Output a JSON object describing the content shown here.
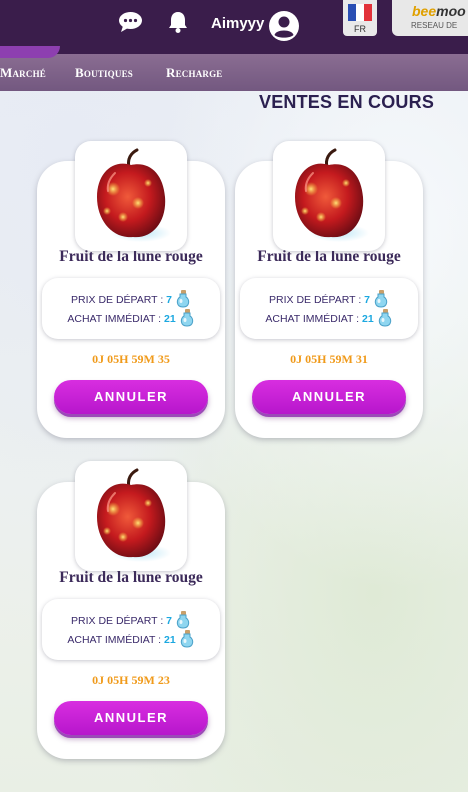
{
  "header": {
    "username": "Aimyyy",
    "lang_code": "FR",
    "brand_logo_a": "bee",
    "brand_logo_b": "moo",
    "brand_sub": "RESEAU DE"
  },
  "nav": {
    "items": [
      {
        "label": "Marché"
      },
      {
        "label": "Boutiques"
      },
      {
        "label": "Recharge"
      }
    ]
  },
  "page_title": "VENTES EN COURS",
  "listings": [
    {
      "name": "Fruit de la lune rouge",
      "start_label": "PRIX DE DÉPART :",
      "start_value": "7",
      "buy_label": "ACHAT IMMÉDIAT :",
      "buy_value": "21",
      "timer": "0J 05H 59M 35",
      "button": "ANNULER"
    },
    {
      "name": "Fruit de la lune rouge",
      "start_label": "PRIX DE DÉPART :",
      "start_value": "7",
      "buy_label": "ACHAT IMMÉDIAT :",
      "buy_value": "21",
      "timer": "0J 05H 59M 31",
      "button": "ANNULER"
    },
    {
      "name": "Fruit de la lune rouge",
      "start_label": "PRIX DE DÉPART :",
      "start_value": "7",
      "buy_label": "ACHAT IMMÉDIAT :",
      "buy_value": "21",
      "timer": "0J 05H 59M 23",
      "button": "ANNULER"
    }
  ],
  "colors": {
    "header_bg": "#3a1d4b",
    "button": "#c61fd6",
    "timer": "#f09a1a",
    "price_value": "#1ca8e0"
  },
  "icons": [
    "chat-icon",
    "bell-icon",
    "user-avatar-icon",
    "france-flag-icon",
    "red-moon-fruit-icon",
    "potion-icon"
  ]
}
